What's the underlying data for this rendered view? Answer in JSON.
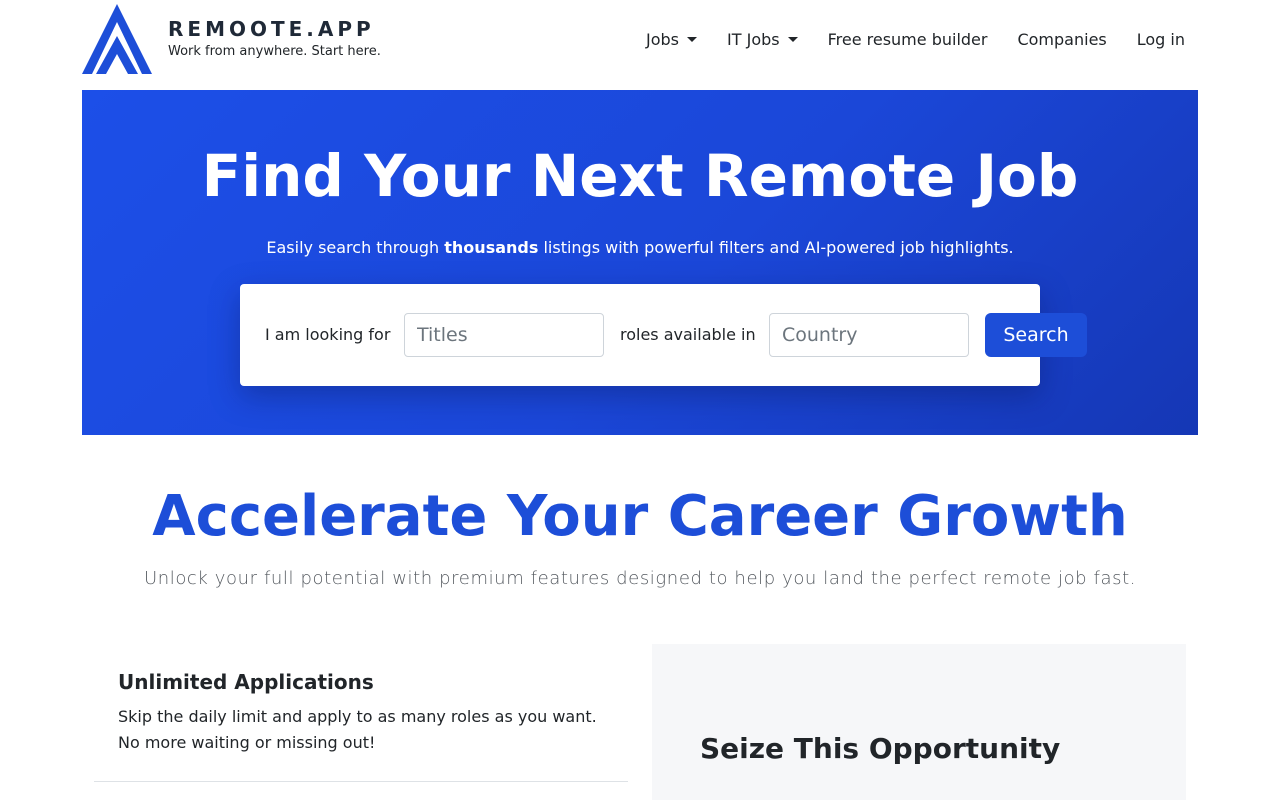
{
  "header": {
    "brand_name": "REMOOTE.APP",
    "brand_tagline": "Work from anywhere. Start here.",
    "logo_icon": "remoote-logo-icon",
    "nav": [
      {
        "label": "Jobs",
        "dropdown": true
      },
      {
        "label": "IT Jobs",
        "dropdown": true
      },
      {
        "label": "Free resume builder",
        "dropdown": false
      },
      {
        "label": "Companies",
        "dropdown": false
      },
      {
        "label": "Log in",
        "dropdown": false
      }
    ]
  },
  "hero": {
    "title": "Find Your Next Remote Job",
    "subtitle_before": "Easily search through ",
    "subtitle_bold": "thousands",
    "subtitle_after": " listings with powerful filters and AI-powered job highlights.",
    "search": {
      "label_looking": "I am looking for",
      "titles_placeholder": "Titles",
      "titles_value": "",
      "label_roles": "roles available in",
      "country_placeholder": "Country",
      "country_value": "",
      "button_label": "Search"
    }
  },
  "section": {
    "title": "Accelerate Your Career Growth",
    "subtitle": "Unlock your full potential with premium features designed to help you land the perfect remote job fast."
  },
  "feature": {
    "title": "Unlimited Applications",
    "description": "Skip the daily limit and apply to as many roles as you want. No more waiting or missing out!"
  },
  "promo": {
    "title": "Seize This Opportunity"
  },
  "colors": {
    "brand_blue": "#1d4ed8",
    "hero_gradient_start": "#1c4fe8",
    "hero_gradient_end": "#1537b5",
    "promo_bg": "#f6f7f9"
  }
}
